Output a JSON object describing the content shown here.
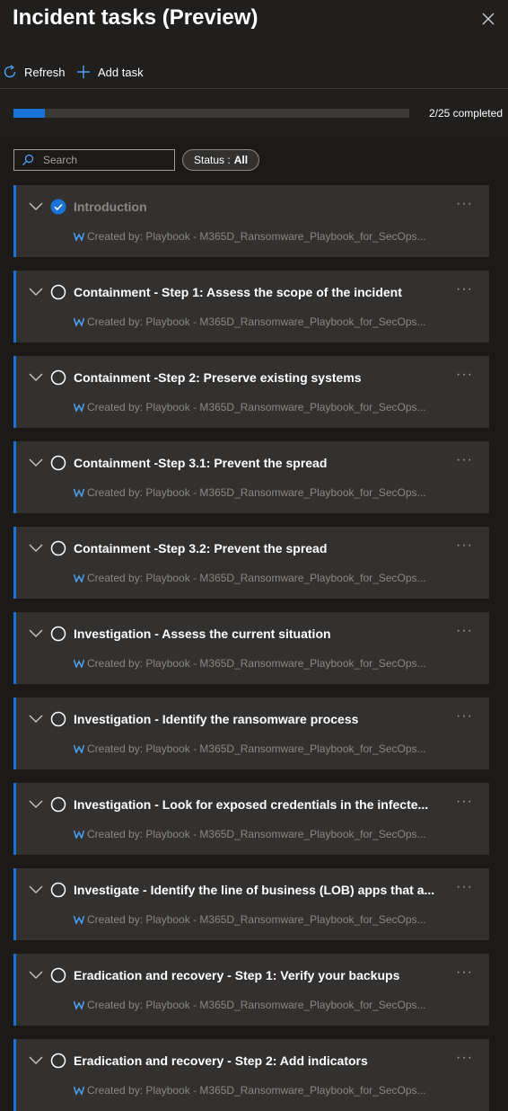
{
  "panel": {
    "title": "Incident tasks (Preview)"
  },
  "toolbar": {
    "refresh_label": "Refresh",
    "add_task_label": "Add task"
  },
  "progress": {
    "completed": 2,
    "total": 25,
    "label": "2/25 completed"
  },
  "search": {
    "placeholder": "Search"
  },
  "status_filter": {
    "label": "Status :",
    "value": "All"
  },
  "colors": {
    "accent": "#1a73d6",
    "panel_bg": "#201f1e",
    "card_bg": "#323130"
  },
  "tasks": [
    {
      "title": "Introduction",
      "created_by": "Created by: Playbook - M365D_Ransomware_Playbook_for_SecOps...",
      "completed": true
    },
    {
      "title": "Containment - Step 1: Assess the scope of the incident",
      "created_by": "Created by: Playbook - M365D_Ransomware_Playbook_for_SecOps...",
      "completed": false
    },
    {
      "title": "Containment -Step 2: Preserve existing systems",
      "created_by": "Created by: Playbook - M365D_Ransomware_Playbook_for_SecOps...",
      "completed": false
    },
    {
      "title": "Containment -Step 3.1: Prevent the spread",
      "created_by": "Created by: Playbook - M365D_Ransomware_Playbook_for_SecOps...",
      "completed": false
    },
    {
      "title": "Containment -Step 3.2: Prevent the spread",
      "created_by": "Created by: Playbook - M365D_Ransomware_Playbook_for_SecOps...",
      "completed": false
    },
    {
      "title": "Investigation - Assess the current situation",
      "created_by": "Created by: Playbook - M365D_Ransomware_Playbook_for_SecOps...",
      "completed": false
    },
    {
      "title": "Investigation - Identify the ransomware process",
      "created_by": "Created by: Playbook - M365D_Ransomware_Playbook_for_SecOps...",
      "completed": false
    },
    {
      "title": "Investigation - Look for exposed credentials in the infecte...",
      "created_by": "Created by: Playbook - M365D_Ransomware_Playbook_for_SecOps...",
      "completed": false
    },
    {
      "title": "Investigate - Identify the line of business (LOB) apps that a...",
      "created_by": "Created by: Playbook - M365D_Ransomware_Playbook_for_SecOps...",
      "completed": false
    },
    {
      "title": "Eradication and recovery - Step 1: Verify your backups",
      "created_by": "Created by: Playbook - M365D_Ransomware_Playbook_for_SecOps...",
      "completed": false
    },
    {
      "title": "Eradication and recovery - Step 2: Add indicators",
      "created_by": "Created by: Playbook - M365D_Ransomware_Playbook_for_SecOps...",
      "completed": false
    }
  ]
}
